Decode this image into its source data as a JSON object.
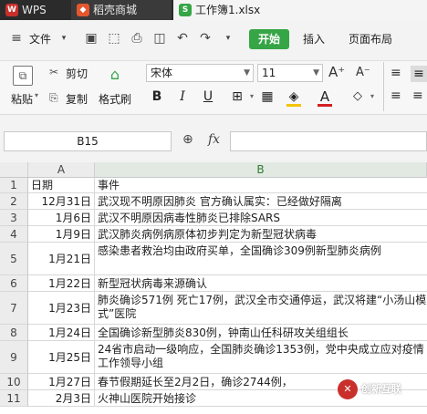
{
  "tabs": {
    "wps": "WPS",
    "store": "稻壳商城",
    "file": "工作簿1.xlsx"
  },
  "menu": {
    "file": "文件",
    "start": "开始",
    "insert": "插入",
    "layout": "页面布局"
  },
  "ribbon": {
    "paste": "粘贴",
    "cut": "剪切",
    "copy": "复制",
    "format_painter": "格式刷",
    "font_name": "宋体",
    "font_size": "11",
    "bold": "B",
    "italic": "I",
    "underline": "U",
    "fill_color": "#f5c400",
    "font_color": "#d22020"
  },
  "formula_bar": {
    "cell_ref": "B15",
    "fx": "fx",
    "content": ""
  },
  "grid": {
    "columns": [
      "A",
      "B"
    ],
    "header_row": {
      "num": "1",
      "a": "日期",
      "b": "事件"
    },
    "rows": [
      {
        "num": "2",
        "a": "12月31日",
        "b": "武汉现不明原因肺炎 官方确认属实：已经做好隔离"
      },
      {
        "num": "3",
        "a": "1月6日",
        "b": "武汉不明原因病毒性肺炎已排除SARS"
      },
      {
        "num": "4",
        "a": "1月9日",
        "b": "武汉肺炎病例病原体初步判定为新型冠状病毒"
      },
      {
        "num": "5",
        "a": "1月21日",
        "b": "感染患者救治均由政府买单，全国确诊309例新型肺炎病例"
      },
      {
        "num": "6",
        "a": "1月22日",
        "b": "新型冠状病毒来源确认"
      },
      {
        "num": "7",
        "a": "1月23日",
        "b": "肺炎确诊571例 死亡17例，武汉全市交通停运，武汉将建“小汤山模式”医院"
      },
      {
        "num": "8",
        "a": "1月24日",
        "b": "全国确诊新型肺炎830例，钟南山任科研攻关组组长"
      },
      {
        "num": "9",
        "a": "1月25日",
        "b": "24省市启动一级响应，全国肺炎确诊1353例，党中央成立应对疫情工作领导小组"
      },
      {
        "num": "10",
        "a": "1月27日",
        "b": "春节假期延长至2月2日，确诊2744例，"
      },
      {
        "num": "11",
        "a": "2月3日",
        "b": "火神山医院开始接诊"
      }
    ]
  },
  "watermark": {
    "text": "创新互联",
    "logo": "✕"
  }
}
